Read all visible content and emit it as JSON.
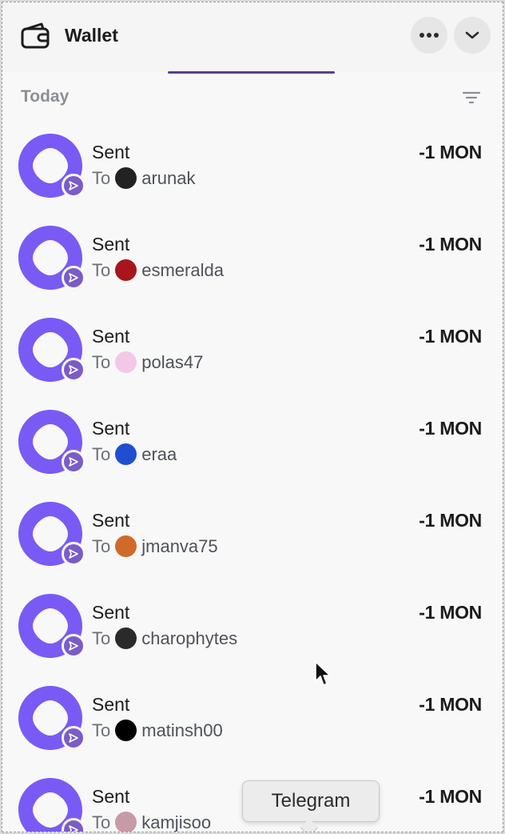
{
  "header": {
    "title": "Wallet",
    "icon": "wallet-icon",
    "more_icon": "more-horizontal-icon",
    "collapse_icon": "chevron-down-icon"
  },
  "section": {
    "label": "Today",
    "filter_icon": "filter-icon"
  },
  "colors": {
    "accent": "#7b5cc6",
    "token": "#7a5af5",
    "tab_indicator": "#5a3f8a",
    "muted": "#8a8f98"
  },
  "transactions": [
    {
      "type": "Sent",
      "amount": "-1 MON",
      "to_label": "To",
      "recipient": "arunak",
      "avatar_color": "#222222"
    },
    {
      "type": "Sent",
      "amount": "-1 MON",
      "to_label": "To",
      "recipient": "esmeralda",
      "avatar_color": "#a8151c"
    },
    {
      "type": "Sent",
      "amount": "-1 MON",
      "to_label": "To",
      "recipient": "polas47",
      "avatar_color": "#f3c8e6"
    },
    {
      "type": "Sent",
      "amount": "-1 MON",
      "to_label": "To",
      "recipient": "eraa",
      "avatar_color": "#1f4fd1"
    },
    {
      "type": "Sent",
      "amount": "-1 MON",
      "to_label": "To",
      "recipient": "jmanva75",
      "avatar_color": "#d06a2a"
    },
    {
      "type": "Sent",
      "amount": "-1 MON",
      "to_label": "To",
      "recipient": "charophytes",
      "avatar_color": "#2a2a2a"
    },
    {
      "type": "Sent",
      "amount": "-1 MON",
      "to_label": "To",
      "recipient": "matinsh00",
      "avatar_color": "#000000"
    },
    {
      "type": "Sent",
      "amount": "-1 MON",
      "to_label": "To",
      "recipient": "kamjisoo",
      "avatar_color": "#c79aa8"
    }
  ],
  "tooltip": {
    "text": "Telegram"
  }
}
